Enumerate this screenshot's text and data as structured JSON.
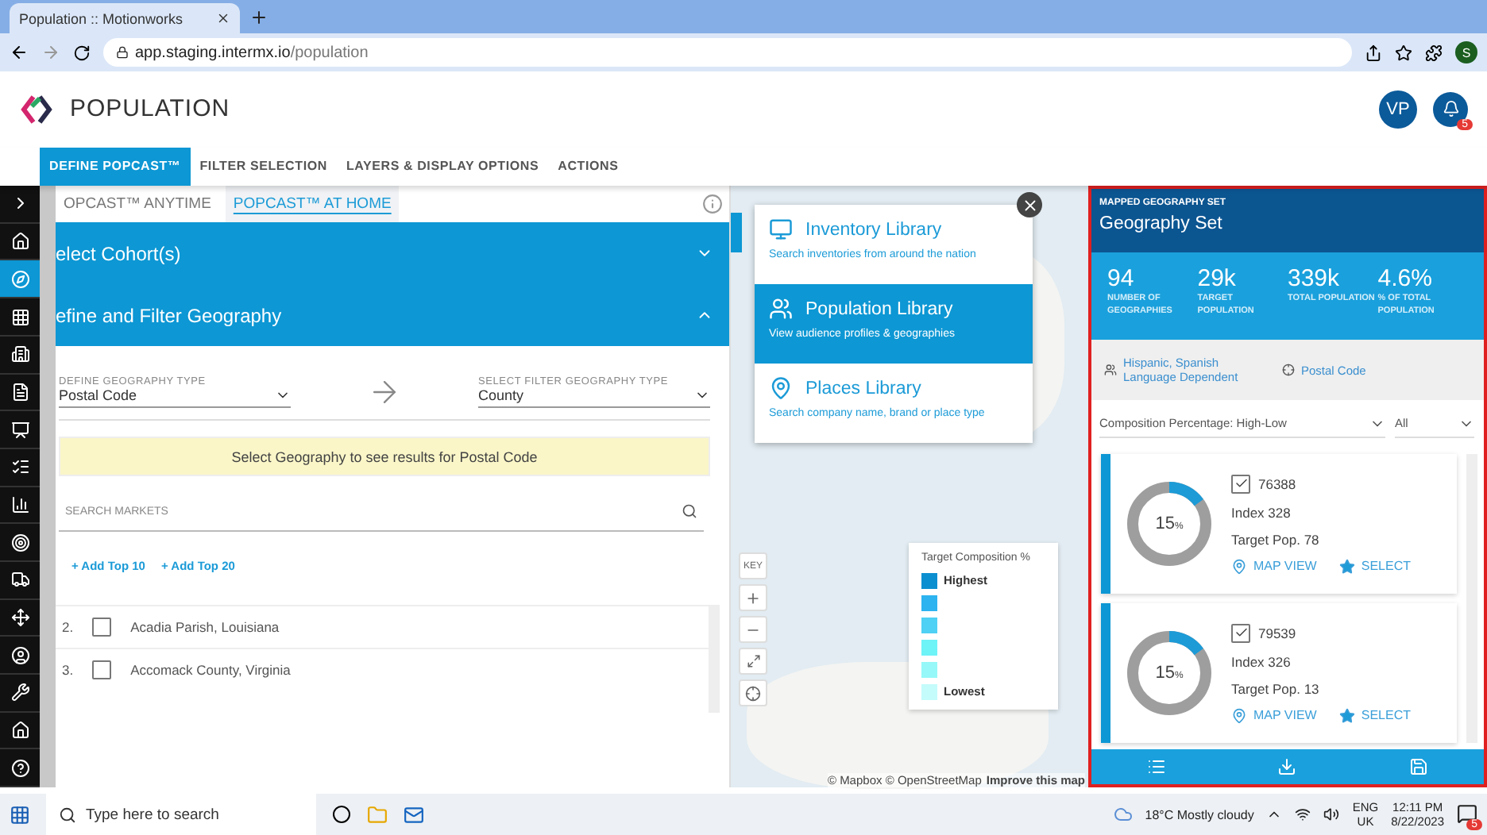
{
  "browser": {
    "tab_title": "Population :: Motionworks",
    "url_host": "app.staging.intermx.io",
    "url_path": "/population",
    "profile": "S"
  },
  "app": {
    "title": "POPULATION",
    "avatar": "VP",
    "notifications": "5"
  },
  "nav_tabs": [
    {
      "label": "DEFINE POPCAST™",
      "selected": true
    },
    {
      "label": "FILTER SELECTION",
      "selected": false
    },
    {
      "label": "LAYERS & DISPLAY OPTIONS",
      "selected": false
    },
    {
      "label": "ACTIONS",
      "selected": false
    }
  ],
  "sidebar": [
    {
      "kind": "expand",
      "selected": false
    },
    {
      "kind": "home",
      "selected": false
    },
    {
      "kind": "compass",
      "selected": true
    },
    {
      "kind": "grid",
      "selected": false
    },
    {
      "kind": "building",
      "selected": false
    },
    {
      "kind": "report",
      "selected": false
    },
    {
      "kind": "billboard",
      "selected": false
    },
    {
      "kind": "checklist",
      "selected": false
    },
    {
      "kind": "chart",
      "selected": false
    },
    {
      "kind": "target",
      "selected": false
    },
    {
      "kind": "vehicles",
      "selected": false
    },
    {
      "kind": "move",
      "selected": false
    },
    {
      "kind": "user",
      "selected": false
    },
    {
      "kind": "wrench",
      "selected": false
    },
    {
      "kind": "home",
      "selected": false
    },
    {
      "kind": "help",
      "selected": false
    }
  ],
  "subtabs": [
    {
      "label": "OPCAST™ ANYTIME",
      "selected": false
    },
    {
      "label": "POPCAST™ AT HOME",
      "selected": true
    }
  ],
  "sections": [
    {
      "title": "elect Cohort(s)",
      "expanded": false
    },
    {
      "title": "efine and Filter Geography",
      "expanded": true
    }
  ],
  "geography": {
    "define": {
      "label": "DEFINE GEOGRAPHY TYPE",
      "value": "Postal Code"
    },
    "filter": {
      "label": "SELECT FILTER GEOGRAPHY TYPE",
      "value": "County"
    }
  },
  "notice": "Select Geography to see results for Postal Code",
  "search": {
    "placeholder": "SEARCH MARKETS"
  },
  "add_links": [
    "+ Add Top 10",
    "+ Add Top 20"
  ],
  "markets": [
    {
      "number": "2.",
      "name": "Acadia Parish, Louisiana",
      "checked": false
    },
    {
      "number": "3.",
      "name": "Accomack County, Virginia",
      "checked": false
    }
  ],
  "libraries": [
    {
      "kind": "monitor",
      "title": "Inventory Library",
      "subtitle": "Search inventories from around the nation",
      "selected": false
    },
    {
      "kind": "people",
      "title": "Population Library",
      "subtitle": "View audience profiles & geographies",
      "selected": true
    },
    {
      "kind": "pin",
      "title": "Places Library",
      "subtitle": "Search company name, brand or place type",
      "selected": false
    }
  ],
  "map_controls": {
    "key": "KEY"
  },
  "legend": {
    "title": "Target Composition %",
    "levels": [
      {
        "label": "Highest",
        "color": "#0c8fd0"
      },
      {
        "color": "#2db3f0"
      },
      {
        "color": "#4fd0f5"
      },
      {
        "color": "#6ef3f7"
      },
      {
        "color": "#96f8f8"
      },
      {
        "label": "Lowest",
        "color": "#c4fbfb"
      }
    ]
  },
  "attribution": {
    "text": "© Mapbox © OpenStreetMap",
    "link": "Improve this map"
  },
  "geography_set": {
    "kicker": "MAPPED GEOGRAPHY SET",
    "title": "Geography Set",
    "stats": [
      {
        "value": "94",
        "label": "NUMBER OF GEOGRAPHIES"
      },
      {
        "value": "29k",
        "label": "TARGET POPULATION"
      },
      {
        "value": "339k",
        "label": "TOTAL POPULATION"
      },
      {
        "value": "4.6%",
        "label": "% OF TOTAL POPULATION"
      }
    ],
    "tags": [
      {
        "kind": "audience",
        "label": "Hispanic, Spanish Language Dependent"
      },
      {
        "kind": "geography",
        "label": "Postal Code"
      }
    ],
    "sort": "Composition Percentage: High-Low",
    "filter": "All",
    "results": [
      {
        "code": "76388",
        "checked": true,
        "percent": "15",
        "unit": "%",
        "level": 0.15,
        "index": "Index 328",
        "target": "Target Pop. 78",
        "map_view": "MAP VIEW",
        "select": "SELECT"
      },
      {
        "code": "79539",
        "checked": true,
        "percent": "15",
        "unit": "%",
        "level": 0.15,
        "index": "Index 326",
        "target": "Target Pop. 13",
        "map_view": "MAP VIEW",
        "select": "SELECT"
      }
    ]
  },
  "taskbar": {
    "search_placeholder": "Type here to search",
    "temperature": "18°C",
    "weather": "Mostly cloudy",
    "language": "ENG",
    "region": "UK",
    "time": "12:11 PM",
    "date": "8/22/2023",
    "notifications": "5"
  }
}
